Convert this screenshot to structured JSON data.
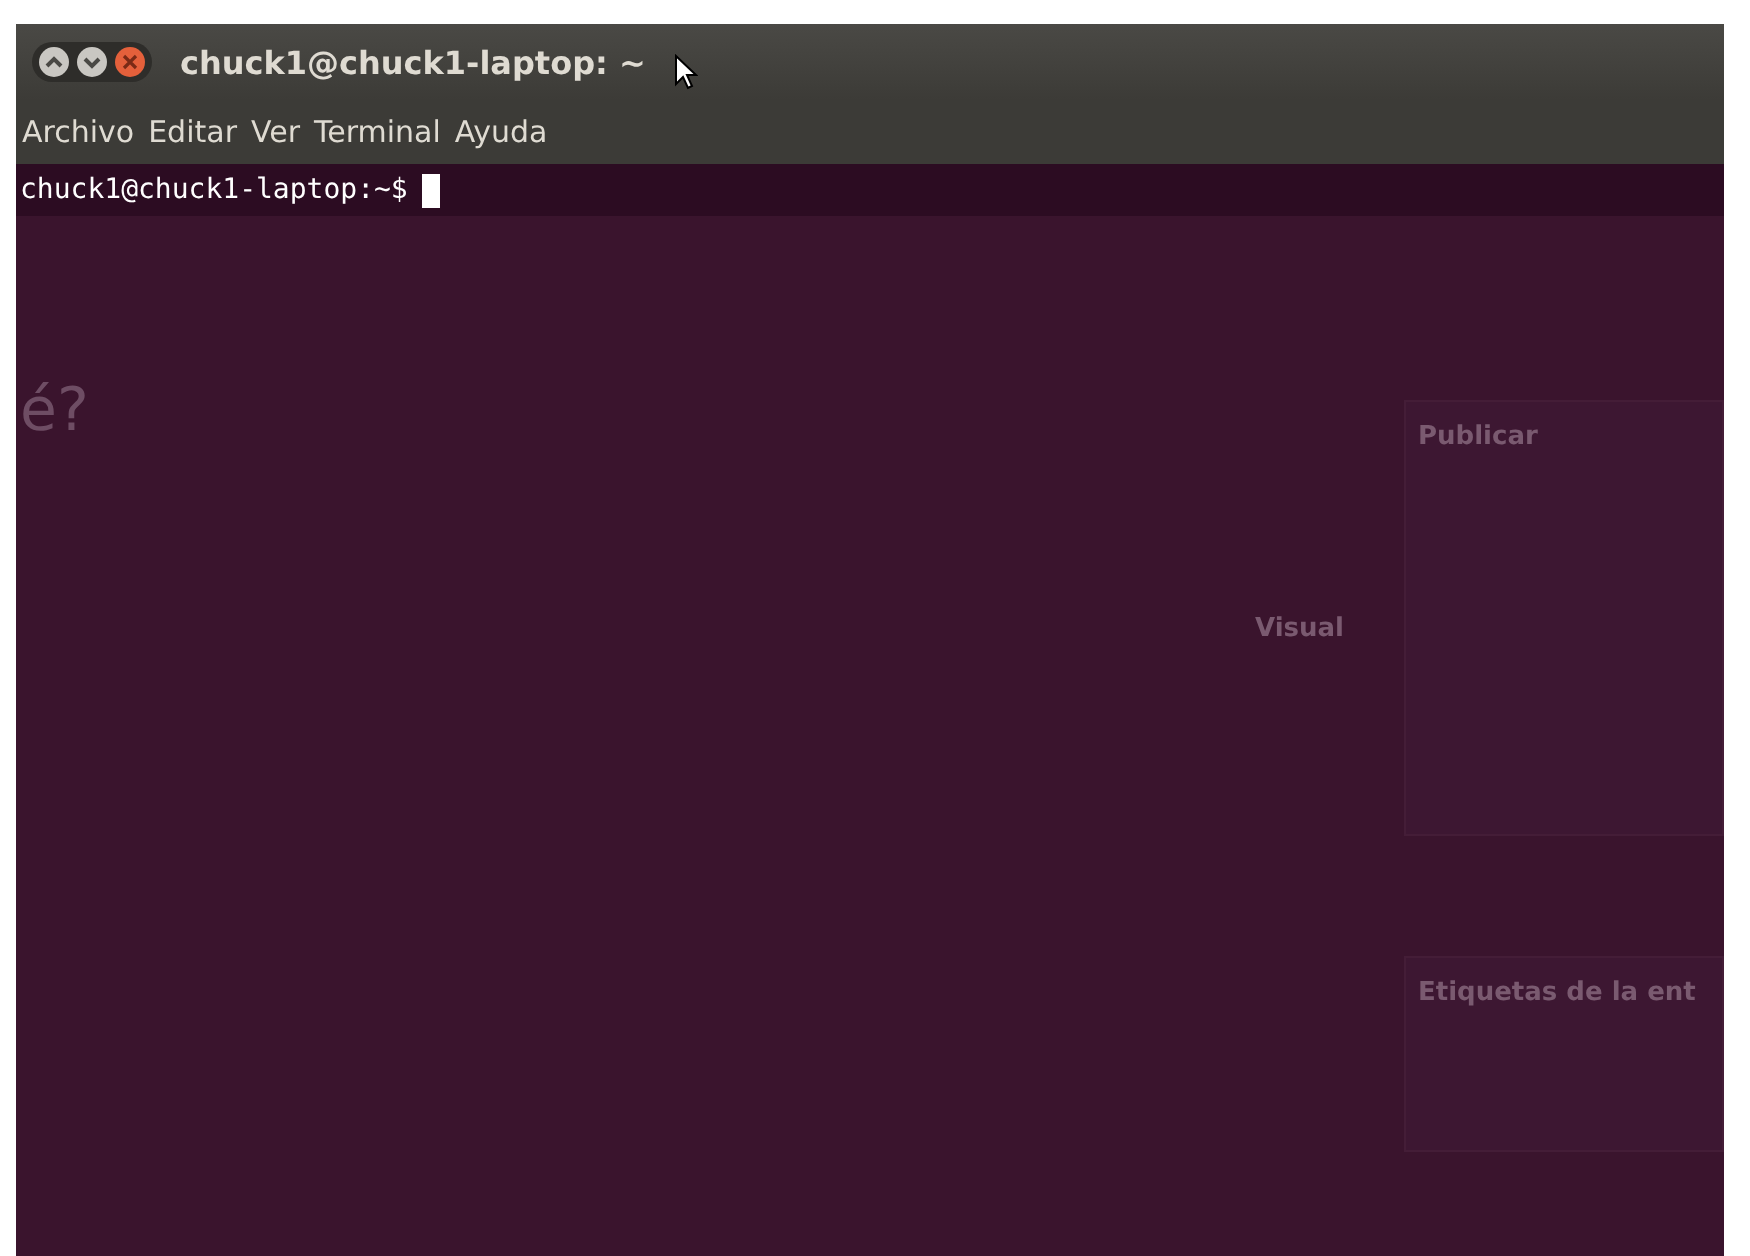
{
  "window": {
    "title": "chuck1@chuck1-laptop: ~"
  },
  "menu": [
    {
      "label": "Archivo"
    },
    {
      "label": "Editar"
    },
    {
      "label": "Ver"
    },
    {
      "label": "Terminal"
    },
    {
      "label": "Ayuda"
    }
  ],
  "terminal": {
    "prompt": "chuck1@chuck1-laptop:~$"
  },
  "background_page": {
    "heading_fragment": "é?",
    "editor_tab": "Visual",
    "sidebar_heading": "Publicar",
    "sidebar_heading_2": "Etiquetas de la ent"
  }
}
